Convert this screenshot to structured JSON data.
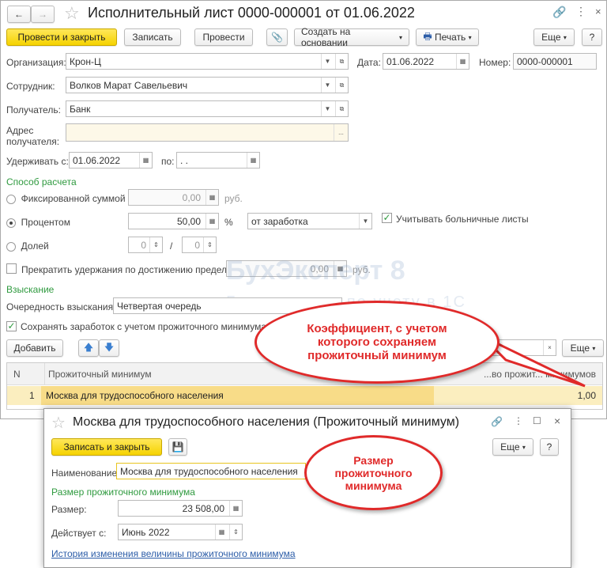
{
  "main": {
    "title": "Исполнительный лист 0000-000001 от 01.06.2022",
    "toolbar": {
      "post_close": "Провести и закрыть",
      "save": "Записать",
      "post": "Провести",
      "create_based": "Создать на основании",
      "print": "Печать",
      "more": "Еще",
      "help": "?"
    },
    "org_label": "Организация:",
    "org_value": "Крон-Ц",
    "date_label": "Дата:",
    "date_value": "01.06.2022",
    "number_label": "Номер:",
    "number_value": "0000-000001",
    "employee_label": "Сотрудник:",
    "employee_value": "Волков Марат Савельевич",
    "recipient_label": "Получатель:",
    "recipient_value": "Банк",
    "address_label": "Адрес получателя:",
    "address_btn": "...",
    "withhold_from_label": "Удерживать с:",
    "withhold_from_value": "01.06.2022",
    "withhold_to_label": "по:",
    "withhold_to_value": " .  .",
    "calc_section": "Способ расчета",
    "fixed_label": "Фиксированной суммой",
    "fixed_value": "0,00",
    "rub": "руб.",
    "percent_label": "Процентом",
    "percent_value": "50,00",
    "percent_sign": "%",
    "percent_base": "от заработка",
    "sick_label": "Учитывать больничные листы",
    "share_label": "Долей",
    "share_num": "0",
    "share_slash": "/",
    "share_den": "0",
    "stop_label": "Прекратить удержания по достижению предела",
    "stop_value": "0,00",
    "stop_rub": "руб.",
    "collection_section": "Взыскание",
    "order_label": "Очередность взыскания:",
    "order_value": "Четвертая очередь",
    "keep_label": "Сохранять заработок с учетом прожиточного минимума",
    "add_btn": "Добавить",
    "more2": "Еще",
    "clear": "×",
    "table": {
      "headers": [
        "N",
        "Прожиточный минимум",
        "...во прожит... минимумов"
      ],
      "rows": [
        {
          "n": "1",
          "name": "Москва для трудоспособного населения",
          "coef": "1,00"
        }
      ]
    }
  },
  "watermark": {
    "brand": "БухЭксперт 8",
    "tagline": "База ответов по учету в 1С"
  },
  "callout1": "Коэффициент, с учетом которого сохраняем прожиточный минимум",
  "callout2": "Размер прожиточного минимума",
  "dialog": {
    "title": "Москва для трудоспособного населения (Прожиточный минимум)",
    "save_close": "Записать и закрыть",
    "more": "Еще",
    "help": "?",
    "name_label": "Наименование:",
    "name_value": "Москва для трудоспособного населения",
    "section": "Размер прожиточного минимума",
    "size_label": "Размер:",
    "size_value": "23 508,00",
    "valid_label": "Действует с:",
    "valid_value": "Июнь 2022",
    "history_link": "История изменения величины прожиточного минимума"
  }
}
